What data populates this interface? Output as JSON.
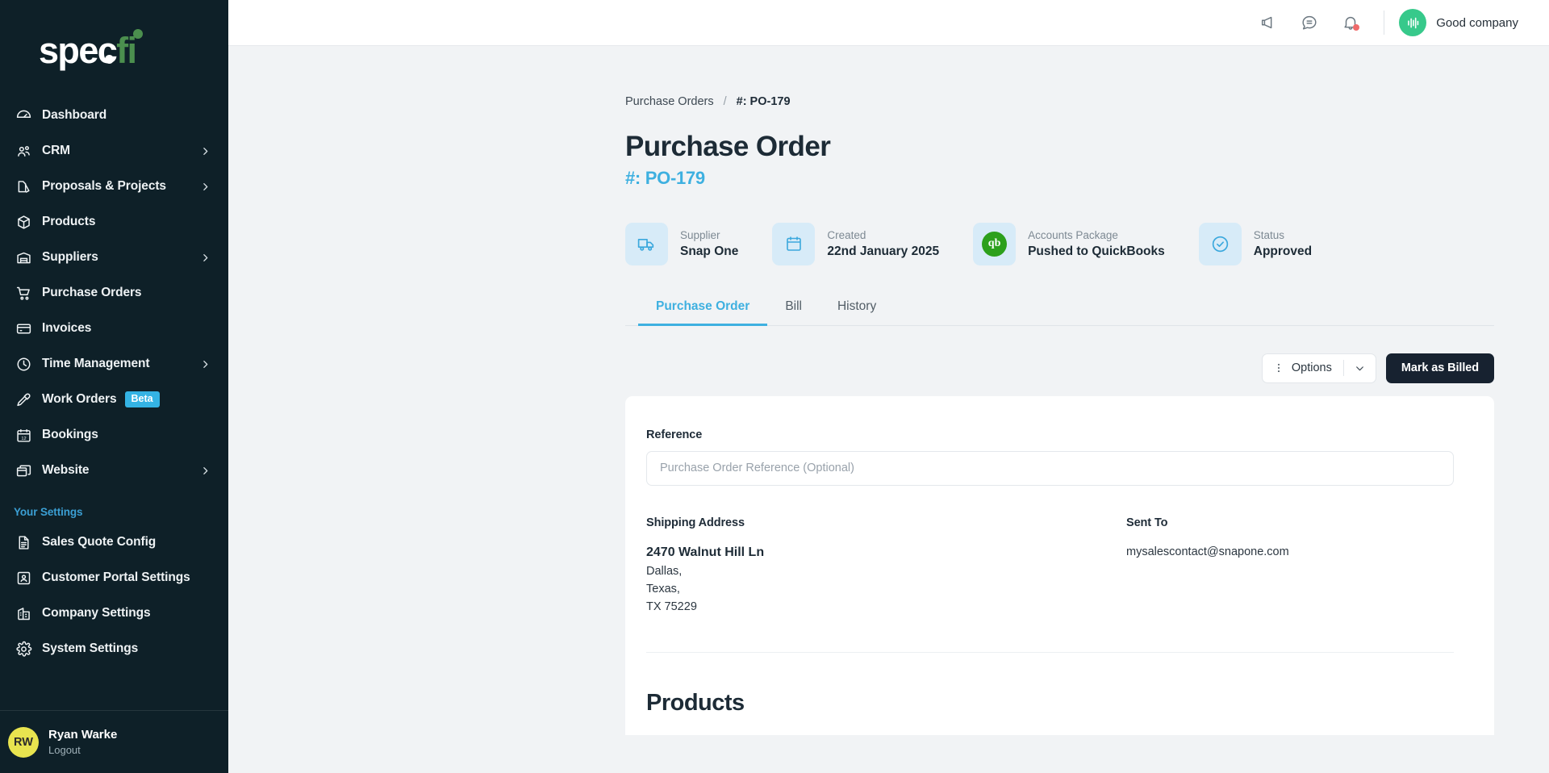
{
  "brand": {
    "logo_text": "spec",
    "logo_accent": "fi",
    "accent_green": "#4b8f4e",
    "sidebar_bg": "#0e2028"
  },
  "sidebar": {
    "items": [
      {
        "label": "Dashboard",
        "icon": "gauge-icon",
        "expandable": false,
        "badge": ""
      },
      {
        "label": "CRM",
        "icon": "users-icon",
        "expandable": true,
        "badge": ""
      },
      {
        "label": "Proposals & Projects",
        "icon": "documents-icon",
        "expandable": true,
        "badge": ""
      },
      {
        "label": "Products",
        "icon": "box-icon",
        "expandable": false,
        "badge": ""
      },
      {
        "label": "Suppliers",
        "icon": "warehouse-icon",
        "expandable": true,
        "badge": ""
      },
      {
        "label": "Purchase Orders",
        "icon": "cart-icon",
        "expandable": false,
        "badge": ""
      },
      {
        "label": "Invoices",
        "icon": "card-icon",
        "expandable": false,
        "badge": ""
      },
      {
        "label": "Time Management",
        "icon": "clock-icon",
        "expandable": true,
        "badge": ""
      },
      {
        "label": "Work Orders",
        "icon": "screwdriver-icon",
        "expandable": false,
        "badge": "Beta"
      },
      {
        "label": "Bookings",
        "icon": "calendar-icon",
        "expandable": false,
        "badge": ""
      },
      {
        "label": "Website",
        "icon": "windows-icon",
        "expandable": true,
        "badge": ""
      }
    ],
    "section_title": "Your Settings",
    "settings_items": [
      {
        "label": "Sales Quote Config",
        "icon": "document-lines-icon"
      },
      {
        "label": "Customer Portal Settings",
        "icon": "user-card-icon"
      },
      {
        "label": "Company Settings",
        "icon": "building-icon"
      },
      {
        "label": "System Settings",
        "icon": "gear-icon"
      }
    ],
    "user": {
      "initials": "RW",
      "name": "Ryan Warke",
      "logout_label": "Logout",
      "avatar_color": "#e8e44f"
    }
  },
  "topbar": {
    "icons": [
      {
        "name": "megaphone-icon"
      },
      {
        "name": "chat-icon"
      },
      {
        "name": "bell-icon",
        "has_notification": true
      }
    ],
    "company_name": "Good company",
    "company_logo_color": "#37c98b"
  },
  "breadcrumb": {
    "parent": "Purchase Orders",
    "separator": "/",
    "current": "#: PO-179"
  },
  "page": {
    "title": "Purchase Order",
    "subtitle": "#: PO-179",
    "subtitle_color": "#3eb0e0"
  },
  "info_cards": [
    {
      "icon": "truck-icon",
      "label": "Supplier",
      "value": "Snap One"
    },
    {
      "icon": "calendar-icon",
      "label": "Created",
      "value": "22nd January 2025"
    },
    {
      "icon": "quickbooks-icon",
      "label": "Accounts Package",
      "value": "Pushed to QuickBooks"
    },
    {
      "icon": "check-circle-icon",
      "label": "Status",
      "value": "Approved"
    }
  ],
  "tabs": [
    {
      "label": "Purchase Order",
      "active": true
    },
    {
      "label": "Bill",
      "active": false
    },
    {
      "label": "History",
      "active": false
    }
  ],
  "actions": {
    "options_label": "Options",
    "primary_label": "Mark as Billed"
  },
  "form": {
    "reference_label": "Reference",
    "reference_value": "",
    "reference_placeholder": "Purchase Order Reference (Optional)"
  },
  "shipping": {
    "label": "Shipping Address",
    "line1": "2470 Walnut Hill Ln",
    "line2": "Dallas,",
    "line3": "Texas,",
    "line4": "TX 75229"
  },
  "sent_to": {
    "label": "Sent To",
    "email": "mysalescontact@snapone.com"
  },
  "products": {
    "title": "Products"
  }
}
